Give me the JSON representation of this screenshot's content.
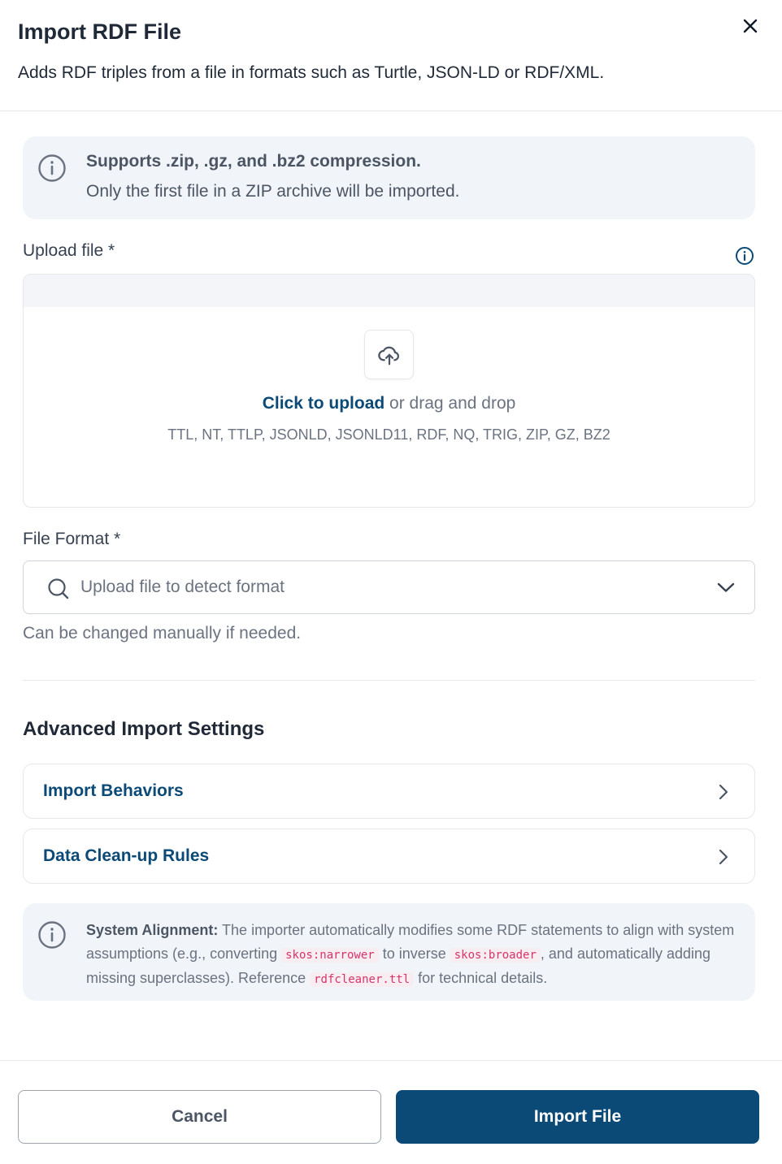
{
  "dialog": {
    "title": "Import RDF File",
    "subtitle": "Adds RDF triples from a file in formats such as Turtle, JSON-LD or RDF/XML."
  },
  "compression_info": {
    "line1": "Supports .zip, .gz, and .bz2 compression.",
    "line2": "Only the first file in a ZIP archive will be imported."
  },
  "upload": {
    "label": "Upload file *",
    "link_text": "Click to upload",
    "rest_text": " or drag and drop",
    "formats": "TTL, NT, TTLP, JSONLD, JSONLD11, RDF, NQ, TRIG, ZIP, GZ, BZ2"
  },
  "file_format": {
    "label": "File Format *",
    "placeholder": "Upload file to detect format",
    "hint": "Can be changed manually if needed."
  },
  "advanced": {
    "title": "Advanced Import Settings",
    "items": [
      {
        "label": "Import Behaviors"
      },
      {
        "label": "Data Clean-up Rules"
      }
    ]
  },
  "system_alignment": {
    "bold": "System Alignment:",
    "text1": " The importer automatically modifies some RDF statements to align with system assumptions (e.g., converting ",
    "code1": "skos:narrower",
    "text2": " to inverse ",
    "code2": "skos:broader",
    "text3": ", and automatically adding missing superclasses). Reference ",
    "code3": "rdfcleaner.ttl",
    "text4": " for technical details."
  },
  "footer": {
    "cancel": "Cancel",
    "submit": "Import File"
  },
  "colors": {
    "primary": "#0b4a77",
    "info_bg": "#f1f5f9",
    "code_text": "#d6336c"
  },
  "icons": [
    "close-icon",
    "info-icon",
    "upload-cloud-icon",
    "search-icon",
    "chevron-down-icon",
    "chevron-right-icon"
  ]
}
